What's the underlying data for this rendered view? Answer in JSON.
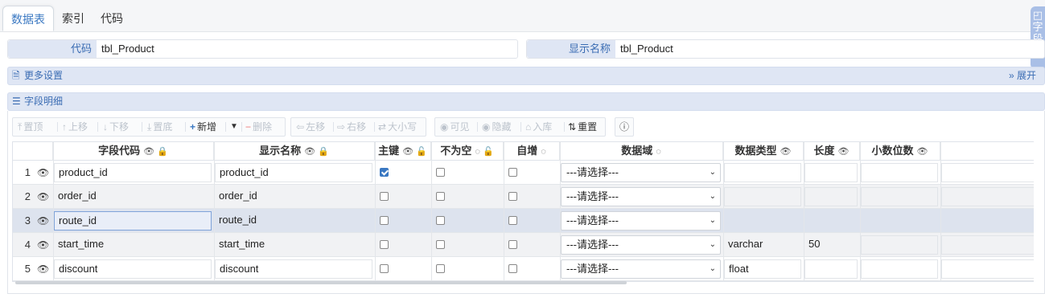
{
  "tabs": [
    {
      "label": "数据表",
      "active": true
    },
    {
      "label": "索引",
      "active": false
    },
    {
      "label": "代码",
      "active": false
    }
  ],
  "side_tab": {
    "label": "字段库"
  },
  "form": {
    "code_label": "代码",
    "code_value": "tbl_Product",
    "display_label": "显示名称",
    "display_value": "tbl_Product"
  },
  "more_settings": {
    "label": "更多设置",
    "expand": "展开"
  },
  "field_detail": {
    "label": "字段明细"
  },
  "toolbar": {
    "top": "置顶",
    "up": "上移",
    "down": "下移",
    "bottom": "置底",
    "add": "新增",
    "delete": "删除",
    "left": "左移",
    "right": "右移",
    "case": "大小写",
    "visible": "可见",
    "hide": "隐藏",
    "store": "入库",
    "reorder": "重置"
  },
  "columns": {
    "code": "字段代码",
    "name": "显示名称",
    "pk": "主键",
    "notnull": "不为空",
    "auto": "自增",
    "domain": "数据域",
    "type": "数据类型",
    "length": "长度",
    "decimal": "小数位数"
  },
  "select_placeholder": "---请选择---",
  "rows": [
    {
      "num": "1",
      "code": "product_id",
      "name": "product_id",
      "pk": true,
      "type": "",
      "length": ""
    },
    {
      "num": "2",
      "code": "order_id",
      "name": "order_id",
      "pk": false,
      "type": "",
      "length": ""
    },
    {
      "num": "3",
      "code": "route_id",
      "name": "route_id",
      "pk": false,
      "type": "",
      "length": ""
    },
    {
      "num": "4",
      "code": "start_time",
      "name": "start_time",
      "pk": false,
      "type": "varchar",
      "length": "50"
    },
    {
      "num": "5",
      "code": "discount",
      "name": "discount",
      "pk": false,
      "type": "float",
      "length": ""
    }
  ],
  "colors": {
    "accent": "#3a78c2",
    "bar": "#dfe6f4",
    "selected_row": "#dde3ee"
  }
}
